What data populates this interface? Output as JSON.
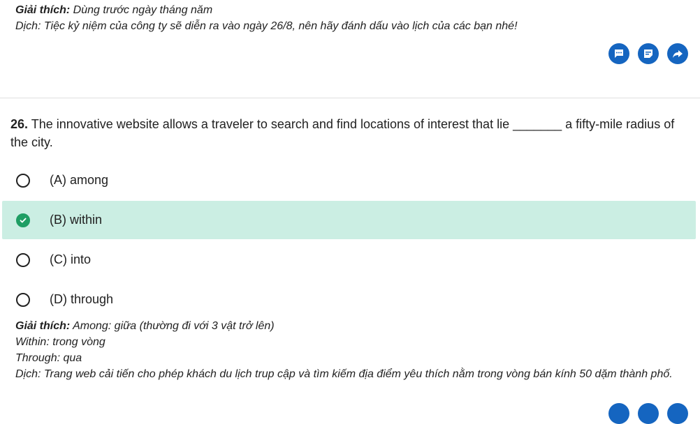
{
  "top_explanation": {
    "label": "Giải thích:",
    "text": " Dùng trước ngày tháng năm",
    "translation": "Dịch: Tiệc kỷ niệm của công ty sẽ diễn ra vào ngày 26/8, nên hãy đánh dấu vào lịch của các bạn nhé!"
  },
  "actions": [
    {
      "name": "comment-button",
      "icon": "chat-bubble-icon"
    },
    {
      "name": "note-button",
      "icon": "note-icon"
    },
    {
      "name": "share-button",
      "icon": "share-arrow-icon"
    }
  ],
  "question": {
    "number": "26.",
    "text": " The innovative website allows a traveler to search and find locations of interest that lie _______ a fifty-mile radius of the city."
  },
  "options": [
    {
      "label": "(A) among",
      "selected": false
    },
    {
      "label": "(B) within",
      "selected": true
    },
    {
      "label": "(C) into",
      "selected": false
    },
    {
      "label": "(D) through",
      "selected": false
    }
  ],
  "explanation": {
    "label": "Giải thích:",
    "line1": " Among: giữa (thường đi với 3 vật trở lên)",
    "line2": "Within: trong vòng",
    "line3": "Through: qua",
    "translation": "Dịch: Trang web cải tiến cho phép khách du lịch trup cập và tìm kiếm địa điểm yêu thích nằm trong vòng bán kính 50 dặm thành phố."
  },
  "colors": {
    "accent": "#1565c0",
    "selected_bg": "#cbeee3",
    "check": "#1f9e64"
  }
}
